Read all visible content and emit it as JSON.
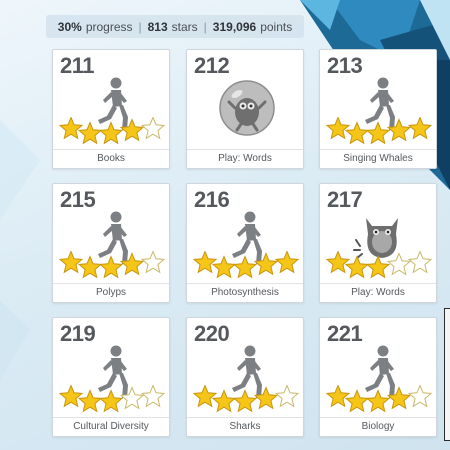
{
  "stats": {
    "progress_value": "30%",
    "progress_label": "progress",
    "stars_value": "813",
    "stars_label": "stars",
    "points_value": "319,096",
    "points_label": "points"
  },
  "cards": [
    {
      "number": "211",
      "label": "Books",
      "icon": "runner-icon",
      "stars": 4
    },
    {
      "number": "212",
      "label": "Play: Words",
      "icon": "bubble-creature-icon",
      "stars": 0
    },
    {
      "number": "213",
      "label": "Singing Whales",
      "icon": "runner-icon",
      "stars": 5
    },
    {
      "number": "215",
      "label": "Polyps",
      "icon": "runner-icon",
      "stars": 4
    },
    {
      "number": "216",
      "label": "Photosynthesis",
      "icon": "runner-icon",
      "stars": 5
    },
    {
      "number": "217",
      "label": "Play: Words",
      "icon": "monster-icon",
      "stars": 3
    },
    {
      "number": "219",
      "label": "Cultural Diversity",
      "icon": "runner-icon",
      "stars": 3
    },
    {
      "number": "220",
      "label": "Sharks",
      "icon": "runner-icon",
      "stars": 4
    },
    {
      "number": "221",
      "label": "Biology",
      "icon": "runner-icon",
      "stars": 4
    }
  ],
  "colors": {
    "star_filled": "#f5c518",
    "star_empty": "#ffffff",
    "figure_gray": "#7c7f83"
  }
}
